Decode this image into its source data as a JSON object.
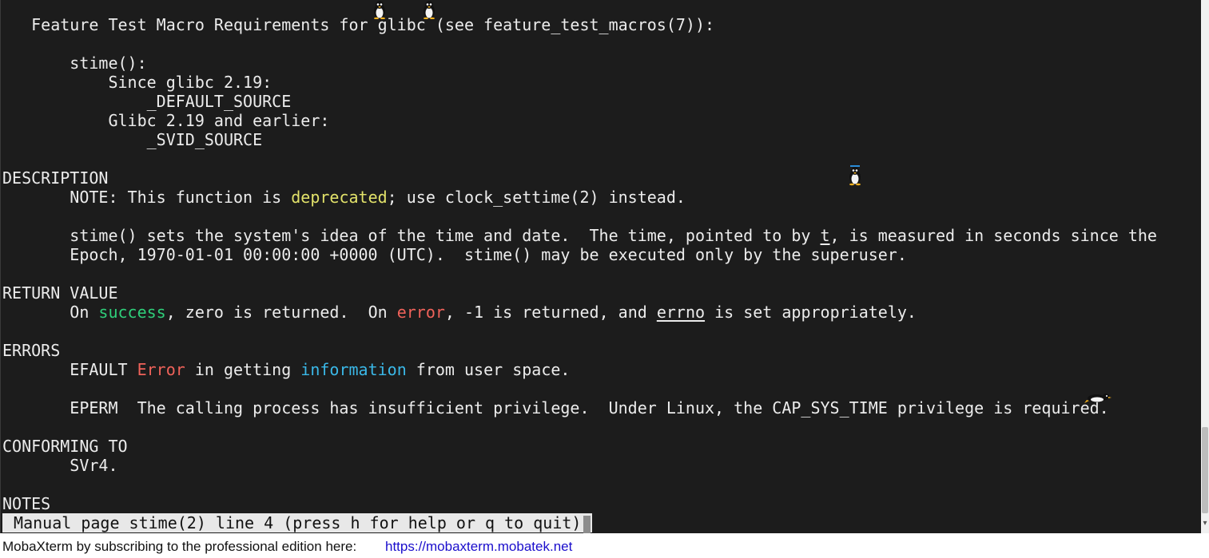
{
  "terminal": {
    "lines": [
      [
        {
          "t": "   Feature Test Macro Requirements for glibc (see feature_test_macros(7)):",
          "c": "w"
        }
      ],
      [],
      [
        {
          "t": "       stime():",
          "c": "w"
        }
      ],
      [
        {
          "t": "           Since glibc 2.19:",
          "c": "w"
        }
      ],
      [
        {
          "t": "               _DEFAULT_SOURCE",
          "c": "w"
        }
      ],
      [
        {
          "t": "           Glibc 2.19 and earlier:",
          "c": "w"
        }
      ],
      [
        {
          "t": "               _SVID_SOURCE",
          "c": "w"
        }
      ],
      [],
      [
        {
          "t": "DESCRIPTION",
          "c": "w"
        }
      ],
      [
        {
          "t": "       NOTE: This function is ",
          "c": "w"
        },
        {
          "t": "deprecated",
          "c": "y"
        },
        {
          "t": "; use clock_settime(2) instead.",
          "c": "w"
        }
      ],
      [],
      [
        {
          "t": "       stime() sets the system's idea of the time and date.  The time, pointed to by ",
          "c": "w"
        },
        {
          "t": "t",
          "c": "w",
          "u": true
        },
        {
          "t": ", is measured in seconds since the",
          "c": "w"
        }
      ],
      [
        {
          "t": "       Epoch, 1970-01-01 00:00:00 +0000 (UTC).  stime() may be executed only by the superuser.",
          "c": "w"
        }
      ],
      [],
      [
        {
          "t": "RETURN VALUE",
          "c": "w"
        }
      ],
      [
        {
          "t": "       On ",
          "c": "w"
        },
        {
          "t": "success",
          "c": "g"
        },
        {
          "t": ", zero is returned.  On ",
          "c": "w"
        },
        {
          "t": "error",
          "c": "r"
        },
        {
          "t": ", -1 is returned, and ",
          "c": "w"
        },
        {
          "t": "errno",
          "c": "w",
          "u": true
        },
        {
          "t": " is set appropriately.",
          "c": "w"
        }
      ],
      [],
      [
        {
          "t": "ERRORS",
          "c": "w"
        }
      ],
      [
        {
          "t": "       EFAULT ",
          "c": "w"
        },
        {
          "t": "Error",
          "c": "r"
        },
        {
          "t": " in getting ",
          "c": "w"
        },
        {
          "t": "information",
          "c": "c"
        },
        {
          "t": " from user space.",
          "c": "w"
        }
      ],
      [],
      [
        {
          "t": "       EPERM  The calling process has insufficient privilege.  Under Linux, the CAP_SYS_TIME privilege is required.",
          "c": "w"
        }
      ],
      [],
      [
        {
          "t": "CONFORMING TO",
          "c": "w"
        }
      ],
      [
        {
          "t": "       SVr4.",
          "c": "w"
        }
      ],
      [],
      [
        {
          "t": "NOTES",
          "c": "w"
        }
      ]
    ],
    "status_line": " Manual page stime(2) line 4 (press h for help or q to quit)"
  },
  "footer": {
    "text": "MobaXterm by subscribing to the professional edition here:",
    "link": "https://mobaxterm.mobatek.net"
  },
  "colors": {
    "terminal_bg": "#1c1c1c",
    "text": "#ececec",
    "yellow": "#e2e26a",
    "green": "#2fcf7a",
    "red": "#f0625a",
    "cyan": "#3ab8e8",
    "link": "#1a0dcc"
  },
  "icons": [
    "penguin-icon",
    "scroll-down-icon"
  ]
}
